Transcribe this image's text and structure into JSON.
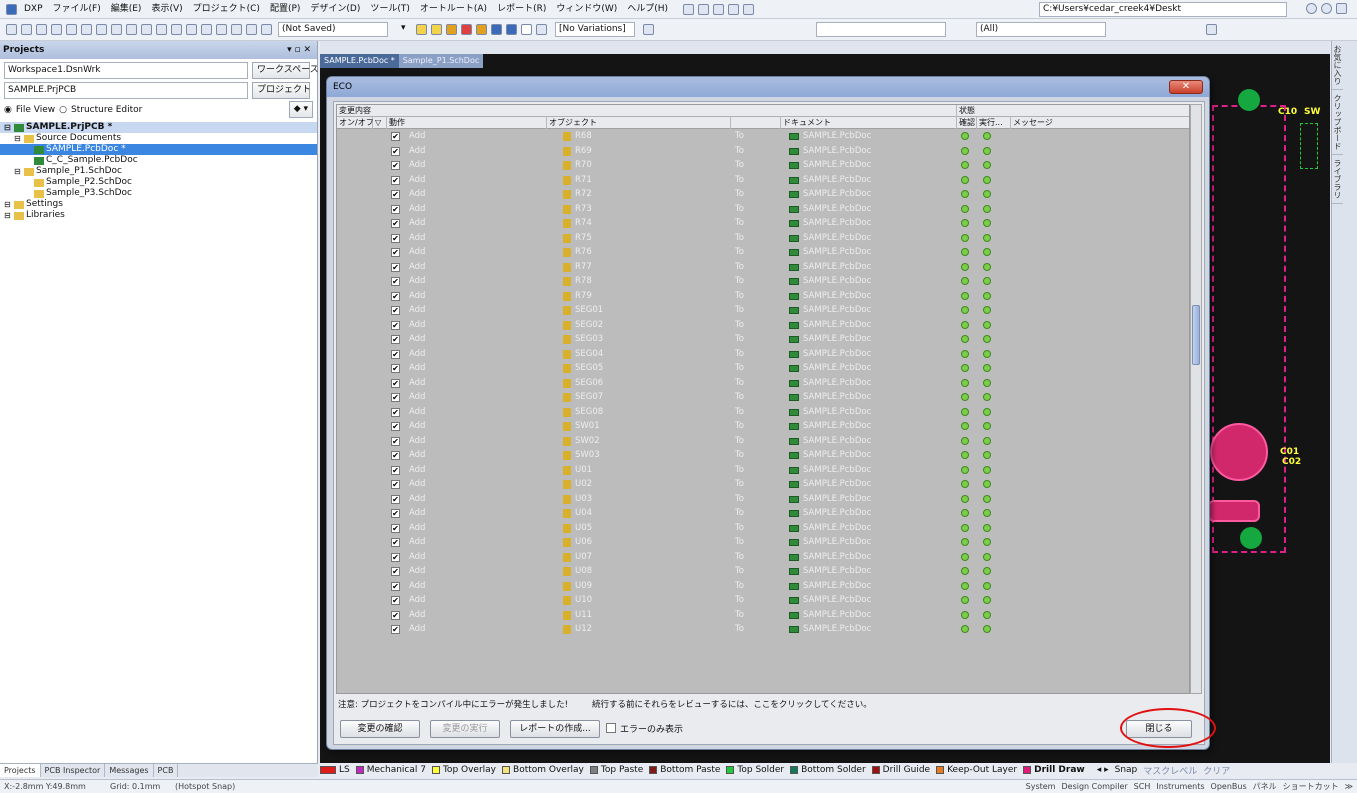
{
  "menubar": {
    "items": [
      "DXP",
      "ファイル(F)",
      "編集(E)",
      "表示(V)",
      "プロジェクト(C)",
      "配置(P)",
      "デザイン(D)",
      "ツール(T)",
      "オートルート(A)",
      "レポート(R)",
      "ウィンドウ(W)",
      "ヘルプ(H)"
    ],
    "path": "C:¥Users¥cedar_creek4¥Deskt"
  },
  "toolbar": {
    "save_state": "(Not Saved)",
    "variations": "[No Variations]",
    "filter": "(All)"
  },
  "projects": {
    "title": "Projects",
    "workspace": "Workspace1.DsnWrk",
    "workspace_btn": "ワークスペース",
    "project": "SAMPLE.PrjPCB",
    "project_btn": "プロジェクト",
    "view_file": "File View",
    "view_structure": "Structure Editor",
    "tree": [
      {
        "label": "SAMPLE.PrjPCB *",
        "level": 0,
        "bold": true,
        "selected": true
      },
      {
        "label": "Source Documents",
        "level": 1
      },
      {
        "label": "SAMPLE.PcbDoc *",
        "level": 2,
        "highlight": true
      },
      {
        "label": "C_C_Sample.PcbDoc",
        "level": 2
      },
      {
        "label": "Sample_P1.SchDoc",
        "level": 1
      },
      {
        "label": "Sample_P2.SchDoc",
        "level": 2
      },
      {
        "label": "Sample_P3.SchDoc",
        "level": 2
      },
      {
        "label": "Settings",
        "level": 0
      },
      {
        "label": "Libraries",
        "level": 0
      }
    ]
  },
  "bottom_tabs": [
    "Projects",
    "PCB Inspector",
    "Messages",
    "PCB"
  ],
  "status": {
    "coords": "X:-2.8mm Y:49.8mm",
    "grid": "Grid: 0.1mm",
    "snap": "(Hotspot Snap)",
    "right": [
      "System",
      "Design Compiler",
      "SCH",
      "Instruments",
      "OpenBus",
      "パネル",
      "ショートカット",
      "≫"
    ]
  },
  "doc_tabs": [
    "SAMPLE.PcbDoc *",
    "Sample_P1.SchDoc"
  ],
  "right_tabs": [
    "お気に入り",
    "クリップボード",
    "ライブラリ"
  ],
  "layers": [
    {
      "name": "LS",
      "color": "#e21b1b"
    },
    {
      "name": "Mechanical 7",
      "color": "#c02ac0"
    },
    {
      "name": "Top Overlay",
      "color": "#ffff3a"
    },
    {
      "name": "Bottom Overlay",
      "color": "#f4e27a"
    },
    {
      "name": "Top Paste",
      "color": "#808080"
    },
    {
      "name": "Bottom Paste",
      "color": "#801818"
    },
    {
      "name": "Top Solder",
      "color": "#22c93a"
    },
    {
      "name": "Bottom Solder",
      "color": "#127a5a"
    },
    {
      "name": "Drill Guide",
      "color": "#a01010"
    },
    {
      "name": "Keep-Out Layer",
      "color": "#e87a20"
    },
    {
      "name": "Drill Draw",
      "color": "#e21b7a"
    }
  ],
  "layer_extras": [
    "Snap",
    "マスクレベル",
    "クリア"
  ],
  "eco": {
    "title": "ECO",
    "group_changes": "変更内容",
    "group_status": "状態",
    "col_onoff": "オン/オフ",
    "col_action": "動作",
    "col_object": "オブジェクト",
    "col_document": "ドキュメント",
    "col_check": "確認",
    "col_exec": "実行...",
    "col_message": "メッセージ",
    "action": "Add",
    "to": "To",
    "document": "SAMPLE.PcbDoc",
    "objects": [
      "R68",
      "R69",
      "R70",
      "R71",
      "R72",
      "R73",
      "R74",
      "R75",
      "R76",
      "R77",
      "R78",
      "R79",
      "SEG01",
      "SEG02",
      "SEG03",
      "SEG04",
      "SEG05",
      "SEG06",
      "SEG07",
      "SEG08",
      "SW01",
      "SW02",
      "SW03",
      "U01",
      "U02",
      "U03",
      "U04",
      "U05",
      "U06",
      "U07",
      "U08",
      "U09",
      "U10",
      "U11",
      "U12"
    ],
    "notice": "注意: プロジェクトをコンパイル中にエラーが発生しました!",
    "notice2": "続行する前にそれらをレビューするには、ここをクリックしてください。",
    "btn_validate": "変更の確認",
    "btn_execute": "変更の実行",
    "btn_report": "レポートの作成...",
    "errors_only": "エラーのみ表示",
    "btn_close": "閉じる"
  },
  "pcb_labels": [
    "C10",
    "SW",
    "C01",
    "C02"
  ]
}
